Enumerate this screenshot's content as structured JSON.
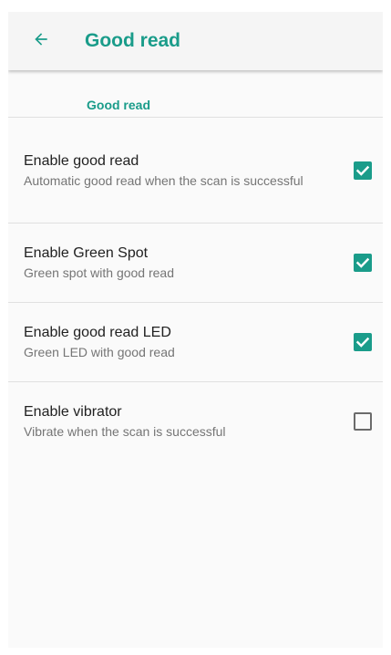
{
  "appbar": {
    "title": "Good read",
    "back_icon": "arrow-back-icon"
  },
  "category": {
    "title": "Good read"
  },
  "colors": {
    "accent": "#1a9c8a",
    "title_text": "#212121",
    "summary_text": "#757575",
    "checkbox_unchecked": "#6b6b6b"
  },
  "preferences": [
    {
      "title": "Enable good read",
      "summary": "Automatic good read when the scan is successful",
      "checked": true
    },
    {
      "title": "Enable Green Spot",
      "summary": "Green spot with good read",
      "checked": true
    },
    {
      "title": "Enable good read LED",
      "summary": "Green LED with good read",
      "checked": true
    },
    {
      "title": "Enable vibrator",
      "summary": "Vibrate when the scan is successful",
      "checked": false
    }
  ]
}
